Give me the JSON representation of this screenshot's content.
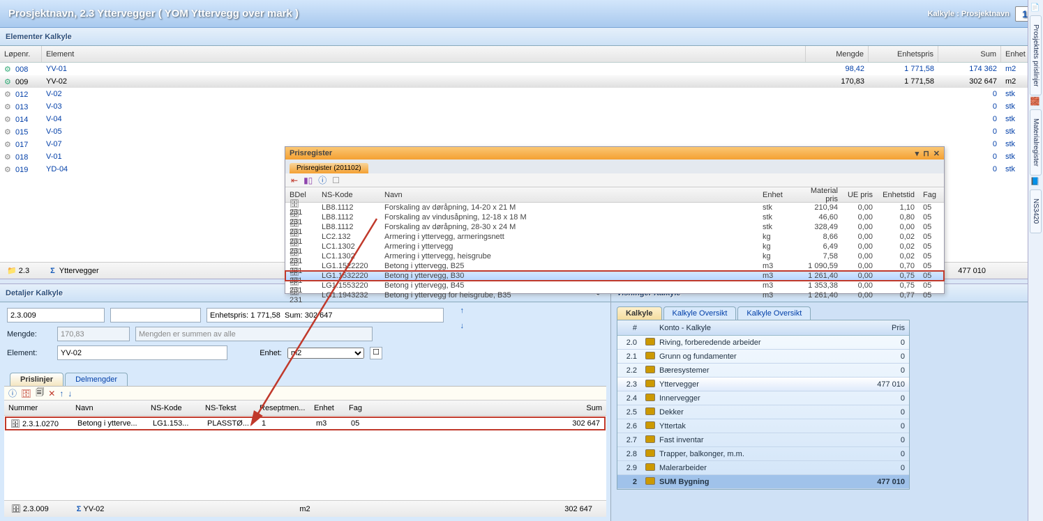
{
  "header": {
    "title_left": "Prosjektnavn,   2.3 Yttervegger   ( YOM Yttervegg over mark )",
    "title_right": "Kalkyle : Prosjektnavn",
    "badge": "1"
  },
  "sections": {
    "elementer": "Elementer Kalkyle",
    "detaljer": "Detaljer Kalkyle",
    "visninger": "Visninger Kalkyle"
  },
  "elem_cols": {
    "lopenr": "Løpenr.",
    "element": "Element",
    "mengde": "Mengde",
    "enhetspris": "Enhetspris",
    "sum": "Sum",
    "enhet": "Enhet"
  },
  "elements": [
    {
      "id": "008",
      "name": "YV-01",
      "mengde": "98,42",
      "ep": "1 771,58",
      "sum": "174 362",
      "enh": "m2",
      "sel": false,
      "act": true
    },
    {
      "id": "009",
      "name": "YV-02",
      "mengde": "170,83",
      "ep": "1 771,58",
      "sum": "302 647",
      "enh": "m2",
      "sel": true,
      "act": true
    },
    {
      "id": "012",
      "name": "V-02",
      "mengde": "",
      "ep": "",
      "sum": "0",
      "enh": "stk",
      "sel": false,
      "act": false
    },
    {
      "id": "013",
      "name": "V-03",
      "mengde": "",
      "ep": "",
      "sum": "0",
      "enh": "stk",
      "sel": false,
      "act": false
    },
    {
      "id": "014",
      "name": "V-04",
      "mengde": "",
      "ep": "",
      "sum": "0",
      "enh": "stk",
      "sel": false,
      "act": false
    },
    {
      "id": "015",
      "name": "V-05",
      "mengde": "",
      "ep": "",
      "sum": "0",
      "enh": "stk",
      "sel": false,
      "act": false
    },
    {
      "id": "017",
      "name": "V-07",
      "mengde": "",
      "ep": "",
      "sum": "0",
      "enh": "stk",
      "sel": false,
      "act": false
    },
    {
      "id": "018",
      "name": "V-01",
      "mengde": "",
      "ep": "",
      "sum": "0",
      "enh": "stk",
      "sel": false,
      "act": false
    },
    {
      "id": "019",
      "name": "YD-04",
      "mengde": "",
      "ep": "",
      "sum": "0",
      "enh": "stk",
      "sel": false,
      "act": false
    }
  ],
  "elem_footer": {
    "code": "2.3",
    "sigma": "Σ",
    "name": "Yttervegger",
    "total": "477 010"
  },
  "prisreg": {
    "title": "Prisregister",
    "tab": "Prisregister (201102)",
    "cols": {
      "bdel": "BDel",
      "ns": "NS-Kode",
      "navn": "Navn",
      "enhet": "Enhet",
      "matpris": "Material pris",
      "ue": "UE pris",
      "etid": "Enhetstid",
      "fag": "Fag"
    },
    "rows": [
      {
        "bdel": "231",
        "ns": "LB8.1112",
        "navn": "Forskaling av døråpning, 14-20 x 21 M",
        "enh": "stk",
        "mp": "210,94",
        "ue": "0,00",
        "et": "1,10",
        "fag": "05"
      },
      {
        "bdel": "231",
        "ns": "LB8.1112",
        "navn": "Forskaling av vindusåpning, 12-18 x 18 M",
        "enh": "stk",
        "mp": "46,60",
        "ue": "0,00",
        "et": "0,80",
        "fag": "05"
      },
      {
        "bdel": "231",
        "ns": "LB8.1112",
        "navn": "Forskaling av døråpning, 28-30 x 24 M",
        "enh": "stk",
        "mp": "328,49",
        "ue": "0,00",
        "et": "0,00",
        "fag": "05"
      },
      {
        "bdel": "231",
        "ns": "LC2.132",
        "navn": "Armering i yttervegg, armeringsnett",
        "enh": "kg",
        "mp": "8,66",
        "ue": "0,00",
        "et": "0,02",
        "fag": "05"
      },
      {
        "bdel": "231",
        "ns": "LC1.1302",
        "navn": "Armering i yttervegg",
        "enh": "kg",
        "mp": "6,49",
        "ue": "0,00",
        "et": "0,02",
        "fag": "05"
      },
      {
        "bdel": "231",
        "ns": "LC1.1302",
        "navn": "Armering i yttervegg, heisgrube",
        "enh": "kg",
        "mp": "7,58",
        "ue": "0,00",
        "et": "0,02",
        "fag": "05"
      },
      {
        "bdel": "231",
        "ns": "LG1.1522220",
        "navn": "Betong i yttervegg, B25",
        "enh": "m3",
        "mp": "1 090,59",
        "ue": "0,00",
        "et": "0,70",
        "fag": "05"
      },
      {
        "bdel": "231",
        "ns": "LG1.1532220",
        "navn": "Betong i yttervegg, B30",
        "enh": "m3",
        "mp": "1 261,40",
        "ue": "0,00",
        "et": "0,75",
        "fag": "05",
        "sel": true
      },
      {
        "bdel": "231",
        "ns": "LG1.1553220",
        "navn": "Betong i yttervegg, B45",
        "enh": "m3",
        "mp": "1 353,38",
        "ue": "0,00",
        "et": "0,75",
        "fag": "05"
      },
      {
        "bdel": "231",
        "ns": "LG1.1943232",
        "navn": "Betong i yttervegg for heisgrube, B35",
        "enh": "m3",
        "mp": "1 261,40",
        "ue": "0,00",
        "et": "0,77",
        "fag": "05"
      }
    ]
  },
  "detaljer": {
    "code": "2.3.009",
    "info": "Enhetspris: 1 771,58  Sum: 302 647",
    "mengde_label": "Mengde:",
    "mengde_val": "170,83",
    "mengde_hint": "Mengden er summen av alle",
    "element_label": "Element:",
    "element_val": "YV-02",
    "enhet_label": "Enhet:",
    "enhet_val": "m2"
  },
  "pl_tabs": {
    "a": "Prislinjer",
    "b": "Delmengder"
  },
  "pl_cols": {
    "num": "Nummer",
    "navn": "Navn",
    "ns": "NS-Kode",
    "nst": "NS-Tekst",
    "res": "Reseptmen...",
    "enh": "Enhet",
    "fag": "Fag",
    "sum": "Sum"
  },
  "pl_row": {
    "num": "2.3.1.0270",
    "navn": "Betong i ytterve...",
    "ns": "LG1.153...",
    "nst": "PLASSTØ...",
    "res": "1",
    "enh": "m3",
    "fag": "05",
    "sum": "302 647"
  },
  "pl_footer": {
    "code": "2.3.009",
    "sigma": "Σ",
    "name": "YV-02",
    "enh": "m2",
    "sum": "302 647"
  },
  "vis_tabs": {
    "a": "Kalkyle",
    "b": "Kalkyle Oversikt",
    "c": "Kalkyle Oversikt"
  },
  "vis_cols": {
    "hash": "#",
    "konto": "Konto - Kalkyle",
    "pris": "Pris"
  },
  "vis_rows": [
    {
      "n": "2.0",
      "name": "Riving, forberedende arbeider",
      "pris": "0"
    },
    {
      "n": "2.1",
      "name": "Grunn og fundamenter",
      "pris": "0"
    },
    {
      "n": "2.2",
      "name": "Bæresystemer",
      "pris": "0"
    },
    {
      "n": "2.3",
      "name": "Yttervegger",
      "pris": "477 010",
      "sel": true
    },
    {
      "n": "2.4",
      "name": "Innervegger",
      "pris": "0"
    },
    {
      "n": "2.5",
      "name": "Dekker",
      "pris": "0"
    },
    {
      "n": "2.6",
      "name": "Yttertak",
      "pris": "0"
    },
    {
      "n": "2.7",
      "name": "Fast inventar",
      "pris": "0"
    },
    {
      "n": "2.8",
      "name": "Trapper, balkonger, m.m.",
      "pris": "0"
    },
    {
      "n": "2.9",
      "name": "Malerarbeider",
      "pris": "0"
    },
    {
      "n": "2",
      "name": "SUM Bygning",
      "pris": "477 010",
      "sum": true
    }
  ],
  "sidebar": {
    "a": "Prosjektets prislinjer",
    "b": "Materialregister",
    "c": "NS3420"
  }
}
